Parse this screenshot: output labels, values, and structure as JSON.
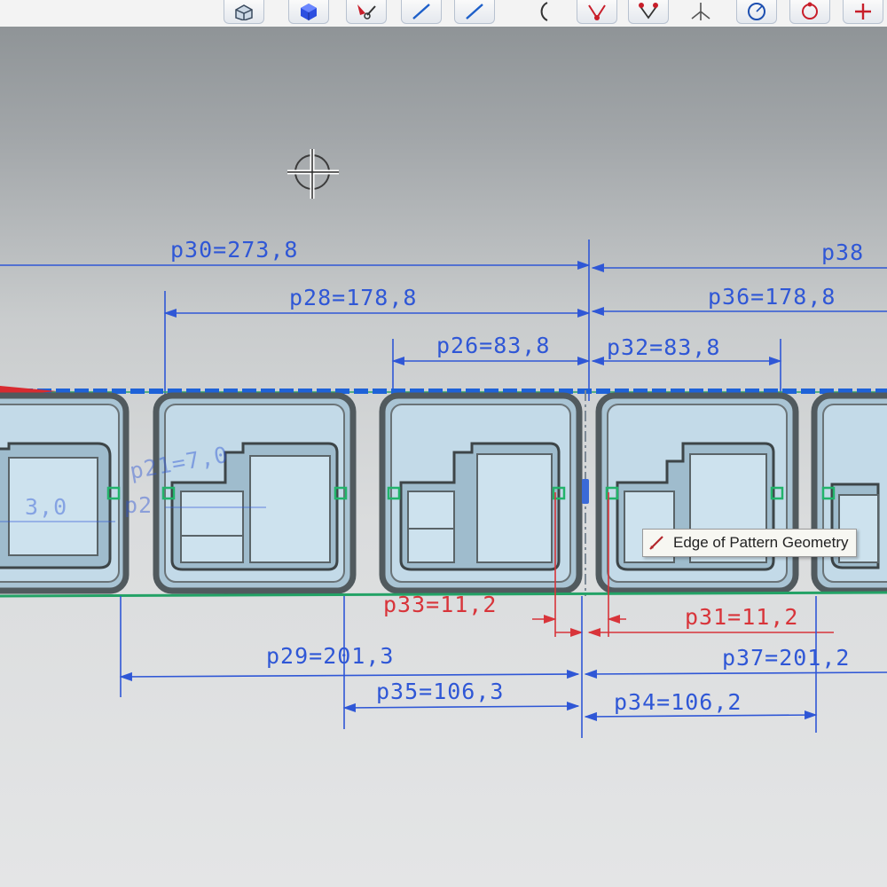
{
  "toolbar": {
    "tools": [
      {
        "icon": "box-view-icon"
      },
      {
        "icon": "solid-cube-icon"
      },
      {
        "icon": "sketch-tool-icon"
      },
      {
        "icon": "line-tool-icon"
      },
      {
        "icon": "line-tool-icon"
      },
      {
        "icon": "arc-tool-icon"
      },
      {
        "icon": "point-constraint-icon"
      },
      {
        "icon": "triangle-constraint-icon"
      },
      {
        "icon": "axis-icon"
      },
      {
        "icon": "circle-tool-icon"
      },
      {
        "icon": "circle-point-tool-icon"
      },
      {
        "icon": "add-icon"
      }
    ]
  },
  "cursor": {
    "icon": "crosshair-cursor-icon"
  },
  "dimensions": {
    "p30": "p30=273,8",
    "p38": "p38",
    "p28": "p28=178,8",
    "p36": "p36=178,8",
    "p26": "p26=83,8",
    "p32": "p32=83,8",
    "p21": "p21=7,0",
    "p21b": "p2",
    "left_partial": "3,0",
    "p33": "p33=11,2",
    "p31": "p31=11,2",
    "p29": "p29=201,3",
    "p37": "p37=201,2",
    "p35": "p35=106,3",
    "p34": "p34=106,2"
  },
  "tooltip": {
    "icon": "edge-icon",
    "text": "Edge of Pattern Geometry"
  },
  "colors": {
    "dimension_blue": "#2f57d6",
    "constraint_red": "#d8343a",
    "baseline_green": "#2aa36b",
    "constraint_green": "#22b36b",
    "part_fill": "#b8d3e3",
    "part_stroke": "#515a5e"
  }
}
